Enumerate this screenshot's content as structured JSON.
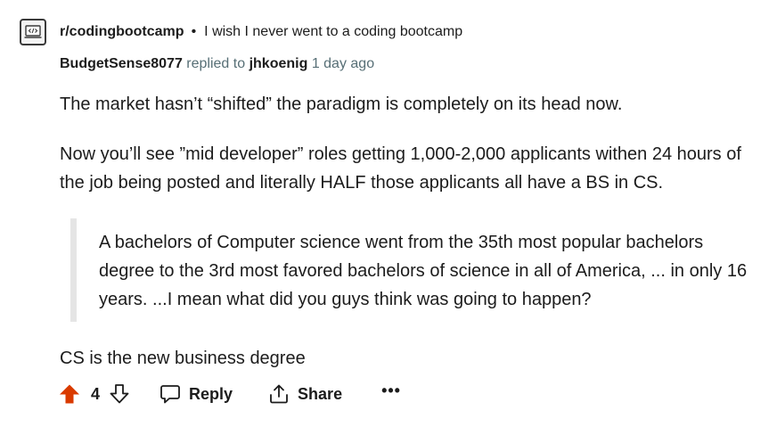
{
  "header": {
    "community_icon": "laptop-code-icon",
    "subreddit": "r/codingbootcamp",
    "separator": "•",
    "post_title": "I wish I never went to a coding bootcamp"
  },
  "meta": {
    "author": "BudgetSense8077",
    "replied_to_label": "replied to",
    "parent_author": "jhkoenig",
    "timestamp": "1 day ago"
  },
  "comment": {
    "paragraph_1": "The market hasn’t “shifted” the paradigm is completely on its head now.",
    "paragraph_2": "Now you’ll see ”mid developer” roles getting 1,000-2,000 applicants withen 24 hours of the job being posted and literally HALF those applicants all have a BS in CS.",
    "quote": "A bachelors of Computer science went from the 35th most popular bachelors degree to the 3rd most favored bachelors of science in all of America, ... in only 16 years. ...I mean what did you guys think was going to happen?",
    "paragraph_3": "CS is the new business degree"
  },
  "actions": {
    "upvote_icon": "upvote-arrow-icon",
    "score": "4",
    "downvote_icon": "downvote-arrow-icon",
    "reply_label": "Reply",
    "share_label": "Share",
    "more_label": "•••"
  },
  "colors": {
    "upvote_active": "#d93a00",
    "text": "#1c1c1c",
    "muted": "#576f76",
    "quote_bar": "#e5e5e5"
  }
}
